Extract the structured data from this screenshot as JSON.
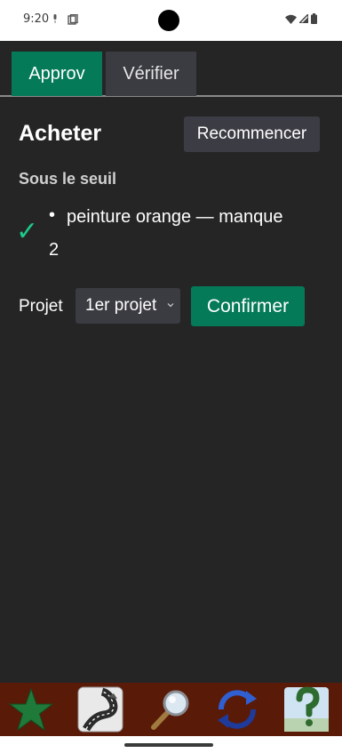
{
  "status": {
    "time": "9:20"
  },
  "tabs": [
    {
      "label": "Approv",
      "active": true
    },
    {
      "label": "Vérifier",
      "active": false
    }
  ],
  "main": {
    "title": "Acheter",
    "restart_label": "Recommencer",
    "section_title": "Sous le seuil",
    "item": {
      "bullet": "•",
      "text_line1": "peinture orange — manque",
      "text_line2": "2",
      "check": "✓"
    },
    "project_label": "Projet",
    "project_selected": "1er projet",
    "confirm_label": "Confirmer"
  },
  "toolbar": {
    "items": [
      "star-icon",
      "road-map-icon",
      "magnifier-icon",
      "sync-icon",
      "help-tree-icon"
    ]
  },
  "colors": {
    "accent": "#047a58",
    "background": "#252526",
    "check": "#1cc88a",
    "toolbar": "#5a1a08"
  }
}
